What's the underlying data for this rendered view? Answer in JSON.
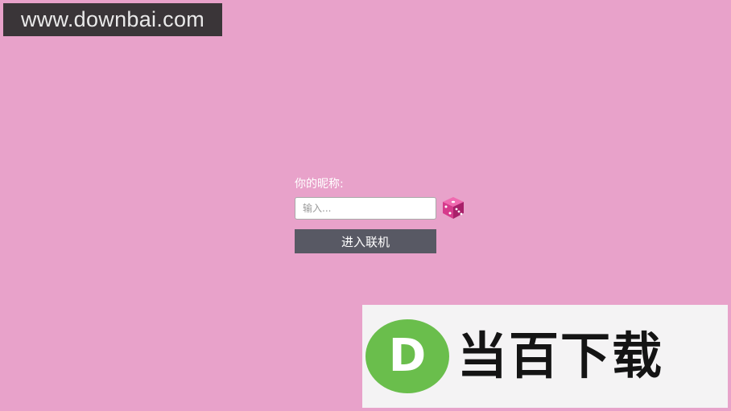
{
  "watermark": {
    "url": "www.downbai.com"
  },
  "login": {
    "nickname_label": "你的昵称:",
    "nickname_placeholder": "输入...",
    "nickname_value": "",
    "random_icon": "dice-icon",
    "enter_button": "进入联机"
  },
  "brand_banner": {
    "logo_letter": "D",
    "name": "当百下载"
  },
  "colors": {
    "background": "#E8A2CA",
    "button": "#585964",
    "dice": "#D63A8C",
    "logo_green": "#6ABE4C"
  }
}
